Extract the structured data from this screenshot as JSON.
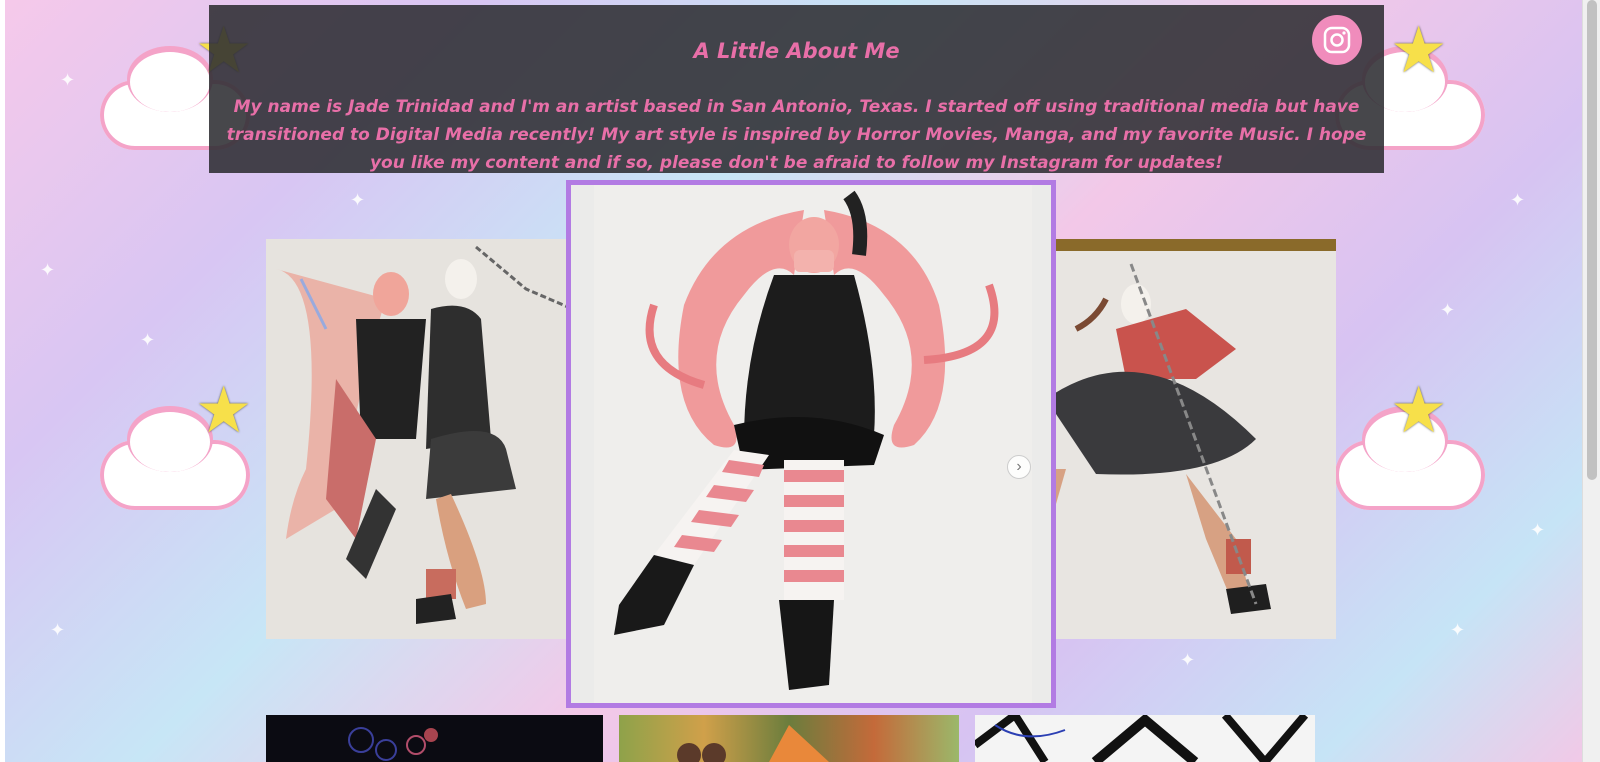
{
  "about": {
    "title": "A Little About Me",
    "body": "My name is Jade Trinidad and I'm an artist based in San Antonio, Texas. I started off using traditional media but have transitioned to Digital Media recently! My art style is inspired by Horror Movies, Manga, and my favorite Music. I hope you like my content and if so, please don't be afraid to follow my Instagram for updates!"
  },
  "social": {
    "instagram_icon": "instagram-icon",
    "color": "#f08cbc"
  },
  "gallery": {
    "next_arrow": "›",
    "accent_color": "#b27be3"
  },
  "colors": {
    "text_pink": "#e86fa8",
    "panel_bg": "#2d2d32"
  }
}
